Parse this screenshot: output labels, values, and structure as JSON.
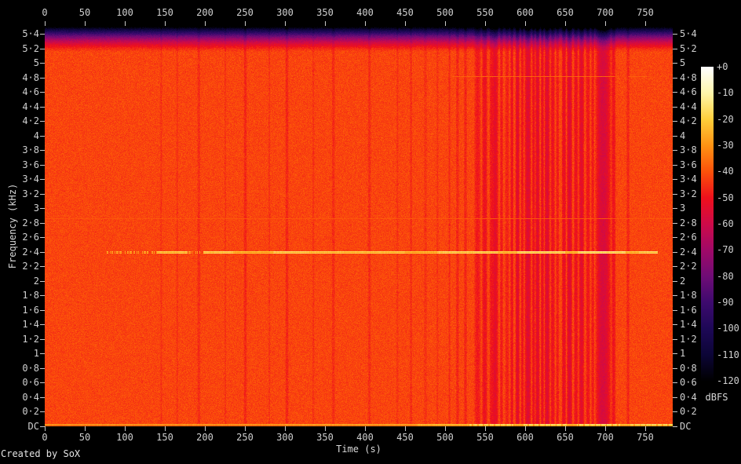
{
  "footer": {
    "credit": "Created by SoX"
  },
  "axes": {
    "time": {
      "label": "Time (s)",
      "ticks": [
        {
          "v": 0,
          "label": "0"
        },
        {
          "v": 50,
          "label": "50"
        },
        {
          "v": 100,
          "label": "100"
        },
        {
          "v": 150,
          "label": "150"
        },
        {
          "v": 200,
          "label": "200"
        },
        {
          "v": 250,
          "label": "250"
        },
        {
          "v": 300,
          "label": "300"
        },
        {
          "v": 350,
          "label": "350"
        },
        {
          "v": 400,
          "label": "400"
        },
        {
          "v": 450,
          "label": "450"
        },
        {
          "v": 500,
          "label": "500"
        },
        {
          "v": 550,
          "label": "550"
        },
        {
          "v": 600,
          "label": "600"
        },
        {
          "v": 650,
          "label": "650"
        },
        {
          "v": 700,
          "label": "700"
        },
        {
          "v": 750,
          "label": "750"
        }
      ]
    },
    "freq": {
      "label": "Frequency (kHz)",
      "ticks": [
        {
          "v": 5.4,
          "label": "5·4"
        },
        {
          "v": 5.2,
          "label": "5·2"
        },
        {
          "v": 5.0,
          "label": "5"
        },
        {
          "v": 4.8,
          "label": "4·8"
        },
        {
          "v": 4.6,
          "label": "4·6"
        },
        {
          "v": 4.4,
          "label": "4·4"
        },
        {
          "v": 4.2,
          "label": "4·2"
        },
        {
          "v": 4.0,
          "label": "4"
        },
        {
          "v": 3.8,
          "label": "3·8"
        },
        {
          "v": 3.6,
          "label": "3·6"
        },
        {
          "v": 3.4,
          "label": "3·4"
        },
        {
          "v": 3.2,
          "label": "3·2"
        },
        {
          "v": 3.0,
          "label": "3"
        },
        {
          "v": 2.8,
          "label": "2·8"
        },
        {
          "v": 2.6,
          "label": "2·6"
        },
        {
          "v": 2.4,
          "label": "2·4"
        },
        {
          "v": 2.2,
          "label": "2·2"
        },
        {
          "v": 2.0,
          "label": "2"
        },
        {
          "v": 1.8,
          "label": "1·8"
        },
        {
          "v": 1.6,
          "label": "1·6"
        },
        {
          "v": 1.4,
          "label": "1·4"
        },
        {
          "v": 1.2,
          "label": "1·2"
        },
        {
          "v": 1.0,
          "label": "1"
        },
        {
          "v": 0.8,
          "label": "0·8"
        },
        {
          "v": 0.6,
          "label": "0·6"
        },
        {
          "v": 0.4,
          "label": "0·4"
        },
        {
          "v": 0.2,
          "label": "0·2"
        },
        {
          "v": 0,
          "label": "DC"
        }
      ]
    },
    "colorbar": {
      "label": "dBFS",
      "ticks": [
        "+0",
        "-10",
        "-20",
        "-30",
        "-40",
        "-50",
        "-60",
        "-70",
        "-80",
        "-90",
        "-100",
        "-110",
        "-120"
      ]
    }
  },
  "chart_data": {
    "type": "heatmap",
    "subtype": "audio-spectrogram",
    "title": "",
    "xlabel": "Time (s)",
    "ylabel": "Frequency (kHz)",
    "colorbar_label": "dBFS",
    "x_range_s": [
      0,
      784
    ],
    "y_range_khz": [
      0,
      5.5125
    ],
    "db_range": [
      0,
      -120
    ],
    "legend_position": "right-colorbar",
    "grid": false,
    "background_level_db": -42,
    "noise_amplitude_db": 4.2,
    "seed": 987654321,
    "palette_stops": [
      [
        0,
        "#ffffff"
      ],
      [
        -10,
        "#fff6aa"
      ],
      [
        -20,
        "#ffce3a"
      ],
      [
        -30,
        "#ff9213"
      ],
      [
        -40,
        "#fc510a"
      ],
      [
        -50,
        "#ee101c"
      ],
      [
        -60,
        "#cd0a49"
      ],
      [
        -70,
        "#a00968"
      ],
      [
        -80,
        "#6f0c76"
      ],
      [
        -90,
        "#3d0a6e"
      ],
      [
        -100,
        "#1d0856"
      ],
      [
        -110,
        "#0c0536"
      ],
      [
        -120,
        "#000000"
      ]
    ],
    "highband_rolloff": {
      "start_khz": 5.15,
      "max_db_drop": 82,
      "exponent": 1.6
    },
    "tones": [
      {
        "freq_khz": 2.4,
        "halo_db_above": 9,
        "segments": [
          {
            "from": 75,
            "to": 140,
            "level": -33,
            "dotted": true
          },
          {
            "from": 140,
            "to": 178,
            "level": -27
          },
          {
            "from": 178,
            "to": 198,
            "level": -33,
            "dotted": true
          },
          {
            "from": 198,
            "to": 235,
            "level": -26
          },
          {
            "from": 235,
            "to": 285,
            "level": -30
          },
          {
            "from": 285,
            "to": 330,
            "level": -25
          },
          {
            "from": 330,
            "to": 450,
            "level": -27
          },
          {
            "from": 450,
            "to": 490,
            "level": -30
          },
          {
            "from": 490,
            "to": 565,
            "level": -25
          },
          {
            "from": 565,
            "to": 590,
            "level": -28
          },
          {
            "from": 590,
            "to": 650,
            "level": -23
          },
          {
            "from": 650,
            "to": 665,
            "level": -29
          },
          {
            "from": 665,
            "to": 725,
            "level": -22
          },
          {
            "from": 725,
            "to": 742,
            "level": -29
          },
          {
            "from": 742,
            "to": 765,
            "level": -25
          }
        ]
      },
      {
        "freq_khz": 4.82,
        "segments": [
          {
            "from": 508,
            "to": 712,
            "level": -37.5
          },
          {
            "from": 728,
            "to": 752,
            "level": -38
          }
        ]
      },
      {
        "freq_khz": 2.86,
        "segments": [
          {
            "from": 0,
            "to": 784,
            "level": -39.5
          }
        ]
      }
    ],
    "dc_line": {
      "segments": [
        {
          "from": 0,
          "to": 300,
          "level": -35
        },
        {
          "from": 300,
          "to": 465,
          "level": -33
        },
        {
          "from": 465,
          "to": 530,
          "level": -29
        },
        {
          "from": 530,
          "to": 585,
          "level": -23,
          "dashed": true
        },
        {
          "from": 585,
          "to": 597,
          "level": -29
        },
        {
          "from": 597,
          "to": 652,
          "level": -22,
          "dashed": true
        },
        {
          "from": 652,
          "to": 664,
          "level": -30
        },
        {
          "from": 664,
          "to": 718,
          "level": -22,
          "dashed": true
        },
        {
          "from": 718,
          "to": 731,
          "level": -29
        },
        {
          "from": 731,
          "to": 784,
          "level": -23,
          "dashed": true
        }
      ]
    },
    "dark_streaks": [
      {
        "t": 540,
        "w": 6,
        "d": 7
      },
      {
        "t": 549,
        "w": 5,
        "d": 9
      },
      {
        "t": 557,
        "w": 3,
        "d": 7
      },
      {
        "t": 562,
        "w": 6,
        "d": 11
      },
      {
        "t": 570,
        "w": 3,
        "d": 7
      },
      {
        "t": 577,
        "w": 4,
        "d": 6
      },
      {
        "t": 583,
        "w": 3,
        "d": 9
      },
      {
        "t": 590,
        "w": 4,
        "d": 12
      },
      {
        "t": 596,
        "w": 3,
        "d": 8
      },
      {
        "t": 603,
        "w": 6,
        "d": 13
      },
      {
        "t": 610,
        "w": 3,
        "d": 9
      },
      {
        "t": 615,
        "w": 4,
        "d": 12
      },
      {
        "t": 621,
        "w": 3,
        "d": 10
      },
      {
        "t": 627,
        "w": 5,
        "d": 13
      },
      {
        "t": 634,
        "w": 4,
        "d": 9
      },
      {
        "t": 640,
        "w": 3,
        "d": 7
      },
      {
        "t": 648,
        "w": 4,
        "d": 10
      },
      {
        "t": 655,
        "w": 5,
        "d": 13
      },
      {
        "t": 663,
        "w": 4,
        "d": 9
      },
      {
        "t": 670,
        "w": 5,
        "d": 12
      },
      {
        "t": 678,
        "w": 4,
        "d": 8
      },
      {
        "t": 684,
        "w": 3,
        "d": 7
      },
      {
        "t": 697,
        "w": 14,
        "d": 15
      },
      {
        "t": 710,
        "w": 4,
        "d": 8
      },
      {
        "t": 728,
        "w": 3,
        "d": 5
      }
    ],
    "minor_streaks": [
      {
        "t": 145,
        "w": 2,
        "d": 3
      },
      {
        "t": 165,
        "w": 2,
        "d": 3
      },
      {
        "t": 192,
        "w": 3,
        "d": 4
      },
      {
        "t": 225,
        "w": 2,
        "d": 3
      },
      {
        "t": 250,
        "w": 3,
        "d": 5
      },
      {
        "t": 280,
        "w": 2,
        "d": 3
      },
      {
        "t": 302,
        "w": 3,
        "d": 5
      },
      {
        "t": 335,
        "w": 2,
        "d": 3
      },
      {
        "t": 360,
        "w": 3,
        "d": 4
      },
      {
        "t": 405,
        "w": 3,
        "d": 4
      },
      {
        "t": 440,
        "w": 2,
        "d": 3
      },
      {
        "t": 457,
        "w": 2,
        "d": 4
      },
      {
        "t": 475,
        "w": 3,
        "d": 3
      },
      {
        "t": 490,
        "w": 2,
        "d": 3
      },
      {
        "t": 505,
        "w": 2,
        "d": 4
      },
      {
        "t": 515,
        "w": 3,
        "d": 5
      },
      {
        "t": 525,
        "w": 3,
        "d": 5
      }
    ]
  }
}
